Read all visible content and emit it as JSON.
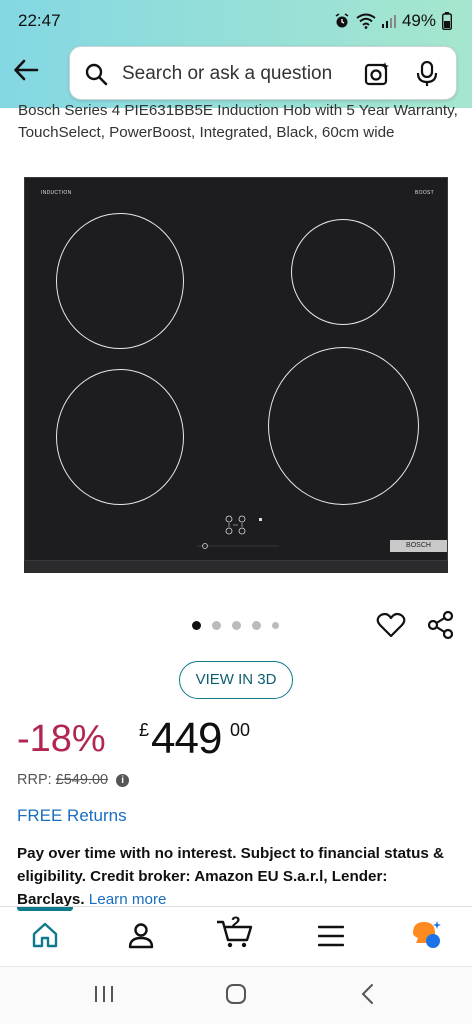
{
  "status_bar": {
    "time": "22:47",
    "battery": "49%",
    "icons": [
      "alarm-icon",
      "wifi-icon",
      "signal-icon",
      "battery-icon"
    ]
  },
  "search": {
    "placeholder": "Search or ask a question"
  },
  "product": {
    "title": "Bosch Series 4 PIE631BB5E Induction Hob with 5 Year Warranty, TouchSelect, PowerBoost, Integrated, Black, 60cm wide",
    "image_labels": {
      "top_left": "INDUCTION",
      "top_right": "BOOST",
      "brand_plate": "BOSCH"
    },
    "carousel": {
      "total": 5,
      "active": 0
    }
  },
  "view3d_label": "VIEW IN 3D",
  "price": {
    "discount": "-18%",
    "currency": "£",
    "whole": "449",
    "fraction": "00",
    "rrp_label": "RRP:",
    "rrp_value": "£549.00"
  },
  "returns_label": "FREE Returns",
  "finance": {
    "text": "Pay over time with no interest. Subject to financial status & eligibility. Credit broker: Amazon EU S.a.r.l, Lender: Barclays.",
    "link": "Learn more"
  },
  "tabs": [
    {
      "name": "home",
      "icon": "home-icon"
    },
    {
      "name": "account",
      "icon": "person-icon"
    },
    {
      "name": "cart",
      "icon": "cart-icon",
      "count": "2"
    },
    {
      "name": "menu",
      "icon": "menu-icon"
    },
    {
      "name": "rufus",
      "icon": "rufus-icon"
    }
  ],
  "colors": {
    "accent": "#0f7a8c",
    "discount": "#b12750",
    "link": "#1a6ec0",
    "header_start": "#84d8e3",
    "header_end": "#a6e6ce"
  }
}
